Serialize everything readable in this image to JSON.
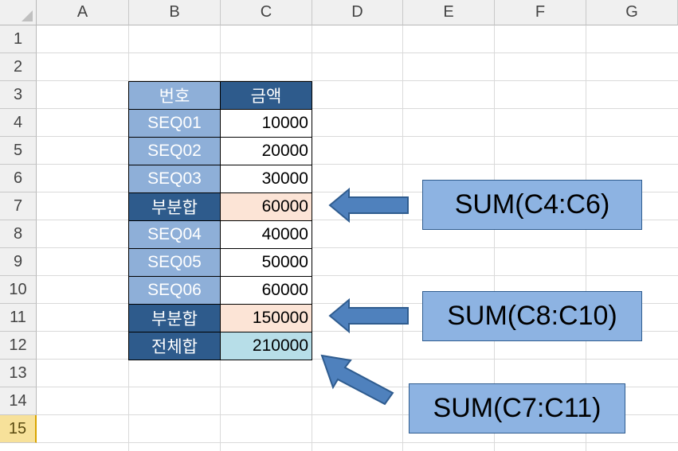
{
  "columns": [
    "A",
    "B",
    "C",
    "D",
    "E",
    "F",
    "G"
  ],
  "rows": [
    "1",
    "2",
    "3",
    "4",
    "5",
    "6",
    "7",
    "8",
    "9",
    "10",
    "11",
    "12",
    "13",
    "14",
    "15"
  ],
  "selected_row": "15",
  "table": {
    "header": {
      "label": "번호",
      "amount": "금액"
    },
    "rows": [
      {
        "label": "SEQ01",
        "value": "10000",
        "style": "light",
        "fill": "white"
      },
      {
        "label": "SEQ02",
        "value": "20000",
        "style": "light",
        "fill": "white"
      },
      {
        "label": "SEQ03",
        "value": "30000",
        "style": "light",
        "fill": "white"
      },
      {
        "label": "부분합",
        "value": "60000",
        "style": "dark",
        "fill": "peach"
      },
      {
        "label": "SEQ04",
        "value": "40000",
        "style": "light",
        "fill": "white"
      },
      {
        "label": "SEQ05",
        "value": "50000",
        "style": "light",
        "fill": "white"
      },
      {
        "label": "SEQ06",
        "value": "60000",
        "style": "light",
        "fill": "white"
      },
      {
        "label": "부분합",
        "value": "150000",
        "style": "dark",
        "fill": "peach"
      },
      {
        "label": "전체합",
        "value": "210000",
        "style": "dark",
        "fill": "aqua"
      }
    ]
  },
  "callouts": [
    {
      "text": "SUM(C4:C6)"
    },
    {
      "text": "SUM(C8:C10)"
    },
    {
      "text": "SUM(C7:C11)"
    }
  ],
  "colors": {
    "header_light": "#8eafd8",
    "header_dark": "#2e5b8c",
    "peach": "#fce4d6",
    "aqua": "#b7dee8",
    "callout_fill": "#8db3e2",
    "arrow_fill": "#4f81bd"
  }
}
